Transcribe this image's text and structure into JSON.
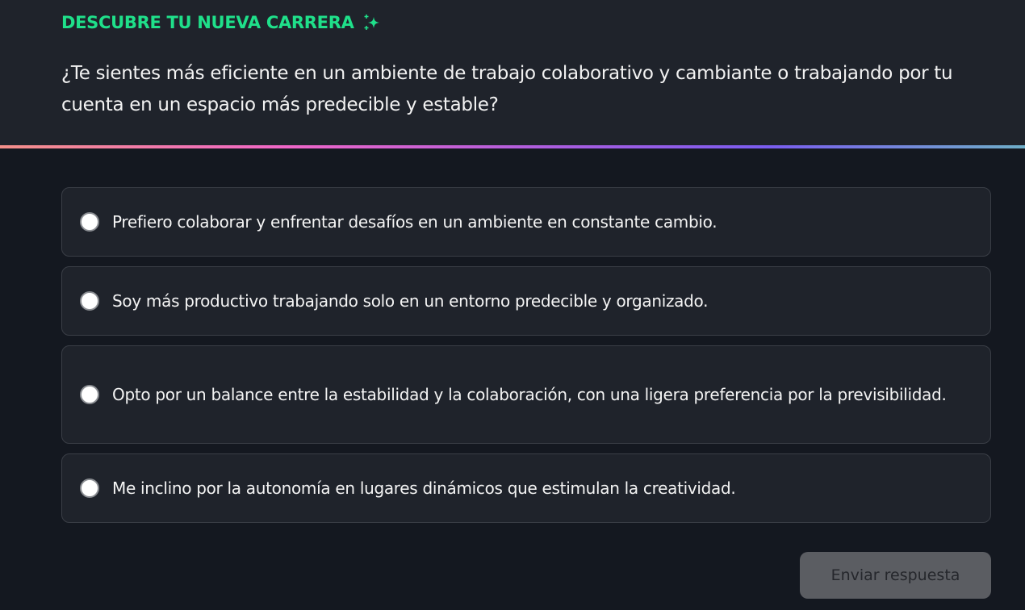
{
  "header": {
    "kicker": "DESCUBRE TU NUEVA CARRERA",
    "kicker_icon": "sparkles-icon",
    "question": "¿Te sientes más eficiente en un ambiente de trabajo colaborativo y cambiante o trabajando por tu cuenta en un espacio más predecible y estable?"
  },
  "options": [
    {
      "label": "Prefiero colaborar y enfrentar desafíos en un ambiente en constante cambio.",
      "selected": false
    },
    {
      "label": "Soy más productivo trabajando solo en un entorno predecible y organizado.",
      "selected": false
    },
    {
      "label": "Opto por un balance entre la estabilidad y la colaboración, con una ligera preferencia por la previsibilidad.",
      "selected": false
    },
    {
      "label": "Me inclino por la autonomía en lugares dinámicos que estimulan la creatividad.",
      "selected": false
    }
  ],
  "submit": {
    "label": "Enviar respuesta",
    "disabled": true
  },
  "colors": {
    "accent": "#1fe08a",
    "background": "#141820",
    "card": "#1f232b"
  }
}
